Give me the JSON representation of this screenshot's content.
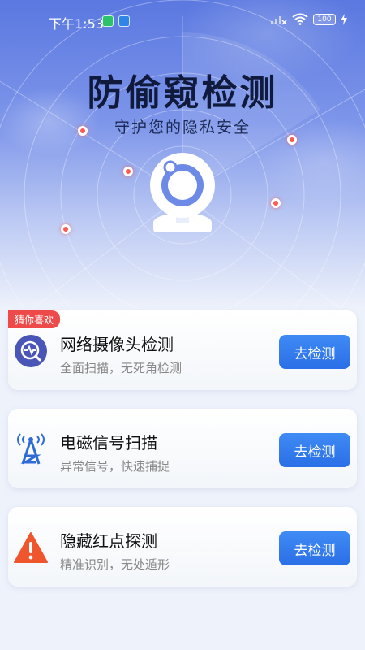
{
  "status_bar": {
    "time": "下午1:53",
    "battery": "100",
    "signal_icon": "signal-x-icon",
    "wifi_icon": "wifi-icon",
    "charging_icon": "bolt-icon"
  },
  "hero": {
    "title": "防偷窥检测",
    "subtitle": "守护您的隐私安全",
    "icon": "webcam-icon"
  },
  "tag": {
    "label": "猜你喜欢"
  },
  "cards": [
    {
      "title": "网络摄像头检测",
      "desc": "全面扫描，无死角检测",
      "button": "去检测",
      "icon": "network-camera-icon"
    },
    {
      "title": "电磁信号扫描",
      "desc": "异常信号，快速捕捉",
      "button": "去检测",
      "icon": "signal-tower-icon"
    },
    {
      "title": "隐藏红点探测",
      "desc": "精准识别，无处遁形",
      "button": "去检测",
      "icon": "warning-triangle-icon"
    }
  ],
  "colors": {
    "accent": "#2a6fe6",
    "hero_top": "#5a78e0",
    "tag": "#ef4a4a",
    "warning": "#f0562e"
  }
}
